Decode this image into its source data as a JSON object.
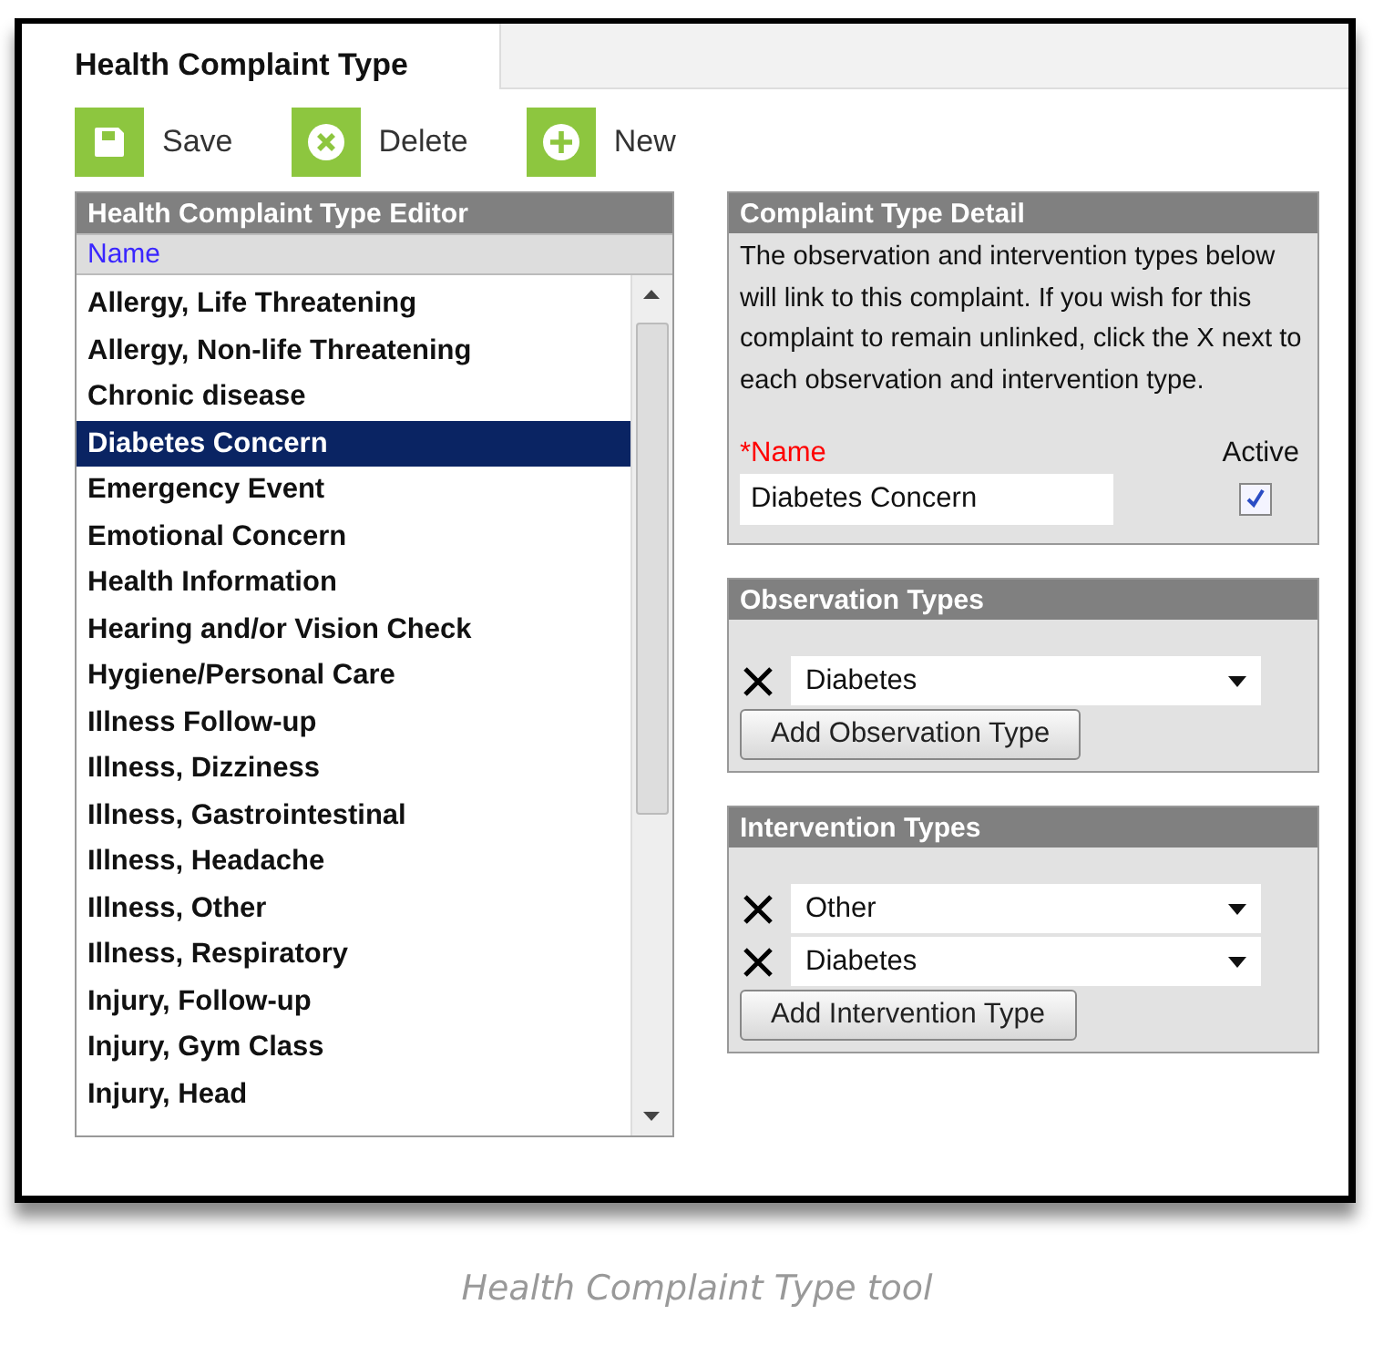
{
  "tab": {
    "label": "Health Complaint Type",
    "selected": true
  },
  "toolbar": [
    {
      "kind": "save",
      "label": "Save"
    },
    {
      "kind": "delete",
      "label": "Delete"
    },
    {
      "kind": "new",
      "label": "New"
    }
  ],
  "editor": {
    "title": "Health Complaint Type Editor",
    "column": "Name",
    "items": [
      {
        "label": "Allergy, Life Threatening",
        "selected": false
      },
      {
        "label": "Allergy, Non-life Threatening",
        "selected": false
      },
      {
        "label": "Chronic disease",
        "selected": false
      },
      {
        "label": "Diabetes Concern",
        "selected": true
      },
      {
        "label": "Emergency Event",
        "selected": false
      },
      {
        "label": "Emotional Concern",
        "selected": false
      },
      {
        "label": "Health Information",
        "selected": false
      },
      {
        "label": "Hearing and/or Vision Check",
        "selected": false
      },
      {
        "label": "Hygiene/Personal Care",
        "selected": false
      },
      {
        "label": "Illness Follow-up",
        "selected": false
      },
      {
        "label": "Illness, Dizziness",
        "selected": false
      },
      {
        "label": "Illness, Gastrointestinal",
        "selected": false
      },
      {
        "label": "Illness, Headache",
        "selected": false
      },
      {
        "label": "Illness, Other",
        "selected": false
      },
      {
        "label": "Illness, Respiratory",
        "selected": false
      },
      {
        "label": "Injury, Follow-up",
        "selected": false
      },
      {
        "label": "Injury, Gym Class",
        "selected": false
      },
      {
        "label": "Injury, Head",
        "selected": false
      }
    ]
  },
  "detail": {
    "title": "Complaint Type Detail",
    "description": "The observation and intervention types below will link to this complaint. If you wish for this complaint to remain unlinked, click the X next to each observation and intervention type.",
    "name_label": "*Name",
    "name_value": "Diabetes Concern",
    "active_label": "Active",
    "active": true
  },
  "observation_types": {
    "title": "Observation Types",
    "items": [
      "Diabetes"
    ],
    "button": "Add Observation Type"
  },
  "intervention_types": {
    "title": "Intervention Types",
    "items": [
      "Other",
      "Diabetes"
    ],
    "button": "Add Intervention Type"
  },
  "caption": "Health Complaint Type tool"
}
